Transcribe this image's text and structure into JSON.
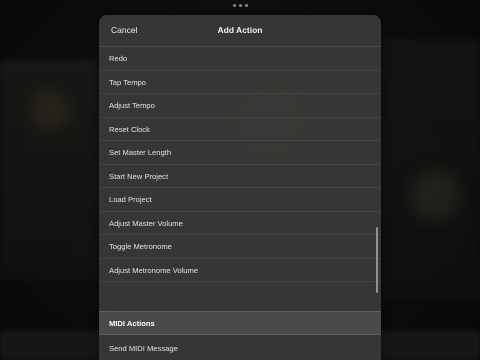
{
  "sheet": {
    "cancel_label": "Cancel",
    "title": "Add Action"
  },
  "actions": [
    {
      "label": "Redo"
    },
    {
      "label": "Tap Tempo"
    },
    {
      "label": "Adjust Tempo"
    },
    {
      "label": "Reset Clock"
    },
    {
      "label": "Set Master Length"
    },
    {
      "label": "Start New Project"
    },
    {
      "label": "Load Project"
    },
    {
      "label": "Adjust Master Volume"
    },
    {
      "label": "Toggle Metronome"
    },
    {
      "label": "Adjust Metronome Volume"
    }
  ],
  "midi_section": {
    "header": "MIDI Actions",
    "items": [
      {
        "label": "Send MIDI Message"
      }
    ]
  },
  "colors": {
    "sheet_background": "#3a3a38",
    "text": "#e4e4e4",
    "background": "#0c0c0c"
  }
}
